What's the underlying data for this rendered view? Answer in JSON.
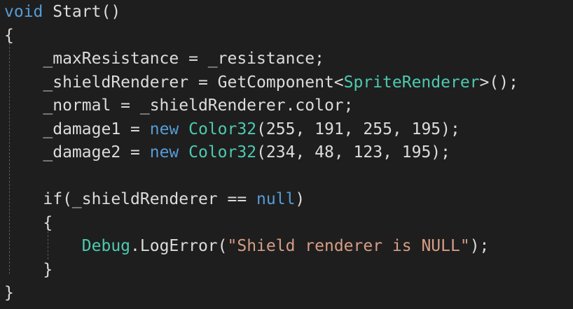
{
  "colors": {
    "background": "#1e1e1e",
    "default": "#dcdcdc",
    "keyword": "#569cd6",
    "type": "#4ec9b0",
    "string": "#d69d85",
    "method": "#dcdcdc"
  },
  "code": {
    "lines": [
      {
        "id": "line-1",
        "tokens": [
          {
            "t": "void",
            "k": "keyword"
          },
          {
            "t": " Start()",
            "k": "default"
          }
        ]
      },
      {
        "id": "line-2",
        "tokens": [
          {
            "t": "{",
            "k": "default"
          }
        ]
      },
      {
        "id": "line-3",
        "tokens": [
          {
            "t": "    _maxResistance = _resistance;",
            "k": "default"
          }
        ]
      },
      {
        "id": "line-4",
        "tokens": [
          {
            "t": "    _shieldRenderer = GetComponent<",
            "k": "default"
          },
          {
            "t": "SpriteRenderer",
            "k": "type"
          },
          {
            "t": ">();",
            "k": "default"
          }
        ]
      },
      {
        "id": "line-5",
        "tokens": [
          {
            "t": "    _normal = _shieldRenderer.color;",
            "k": "default"
          }
        ]
      },
      {
        "id": "line-6",
        "tokens": [
          {
            "t": "    _damage1 = ",
            "k": "default"
          },
          {
            "t": "new",
            "k": "keyword"
          },
          {
            "t": " ",
            "k": "default"
          },
          {
            "t": "Color32",
            "k": "type"
          },
          {
            "t": "(255, 191, 255, 195);",
            "k": "default"
          }
        ]
      },
      {
        "id": "line-7",
        "tokens": [
          {
            "t": "    _damage2 = ",
            "k": "default"
          },
          {
            "t": "new",
            "k": "keyword"
          },
          {
            "t": " ",
            "k": "default"
          },
          {
            "t": "Color32",
            "k": "type"
          },
          {
            "t": "(234, 48, 123, 195);",
            "k": "default"
          }
        ]
      },
      {
        "id": "line-8",
        "tokens": [
          {
            "t": "",
            "k": "default"
          }
        ]
      },
      {
        "id": "line-9",
        "tokens": [
          {
            "t": "    if(_shieldRenderer == ",
            "k": "default"
          },
          {
            "t": "null",
            "k": "keyword"
          },
          {
            "t": ")",
            "k": "default"
          }
        ]
      },
      {
        "id": "line-10",
        "tokens": [
          {
            "t": "    {",
            "k": "default"
          }
        ]
      },
      {
        "id": "line-11",
        "tokens": [
          {
            "t": "        ",
            "k": "default"
          },
          {
            "t": "Debug",
            "k": "type"
          },
          {
            "t": ".LogError(",
            "k": "default"
          },
          {
            "t": "\"Shield renderer is NULL\"",
            "k": "string"
          },
          {
            "t": ");",
            "k": "default"
          }
        ]
      },
      {
        "id": "line-12",
        "tokens": [
          {
            "t": "    }",
            "k": "default"
          }
        ]
      },
      {
        "id": "line-13",
        "tokens": [
          {
            "t": "}",
            "k": "default"
          }
        ]
      }
    ]
  }
}
